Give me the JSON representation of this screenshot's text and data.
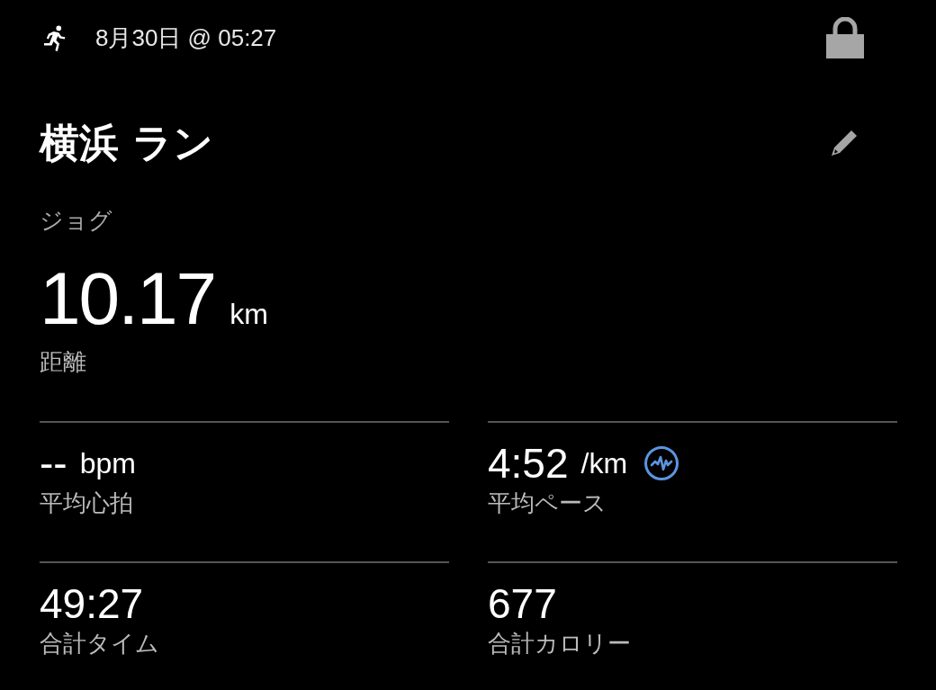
{
  "header": {
    "datetime": "8月30日 @ 05:27",
    "locked": true
  },
  "title": "横浜 ラン",
  "activity_type": "ジョグ",
  "distance": {
    "value": "10.17",
    "unit": "km",
    "label": "距離"
  },
  "stats": [
    {
      "value": "--",
      "unit": "bpm",
      "label": "平均心拍",
      "badge": false
    },
    {
      "value": "4:52",
      "unit": "/km",
      "label": "平均ペース",
      "badge": true
    },
    {
      "value": "49:27",
      "label": "合計タイム",
      "badge": false
    },
    {
      "value": "677",
      "label": "合計カロリー",
      "badge": false
    }
  ]
}
